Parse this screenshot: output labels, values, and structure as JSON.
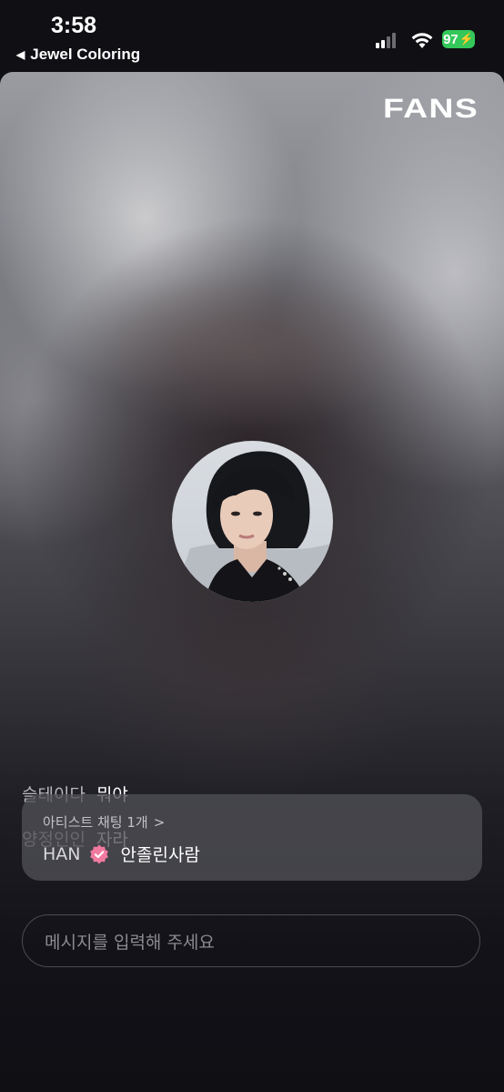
{
  "status_bar": {
    "time": "3:58",
    "back_app": "Jewel Coloring",
    "battery": "97"
  },
  "header": {
    "logo": "FANS"
  },
  "profile": {
    "avatar_icon": "artist-profile-photo"
  },
  "info": [
    {
      "key": "슬테이다",
      "value": "뭐야"
    },
    {
      "key": "양정인인",
      "value": "자라"
    }
  ],
  "artist_card": {
    "count_label": "아티스트 채팅 1개",
    "chevron": ">",
    "artist_name": "HAN",
    "verified_icon": "verified-badge-icon",
    "message": "안졸린사람"
  },
  "composer": {
    "placeholder": "메시지를 입력해 주세요"
  },
  "colors": {
    "battery": "#34c759",
    "badge": "#f07aa0",
    "background": "#0f0f14"
  }
}
